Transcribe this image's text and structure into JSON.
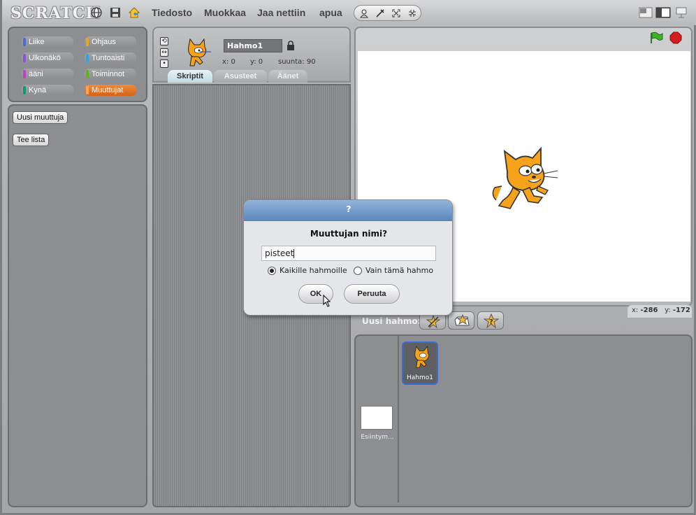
{
  "app": {
    "logo": "SCRATCH"
  },
  "menu": {
    "items": [
      "Tiedosto",
      "Muokkaa",
      "Jaa nettiin",
      "apua"
    ]
  },
  "categories": [
    {
      "label": "Liike",
      "color": "#4a6cd4"
    },
    {
      "label": "Ohjaus",
      "color": "#e1a91a"
    },
    {
      "label": "Ulkonäkö",
      "color": "#8a55d7"
    },
    {
      "label": "Tuntoaisti",
      "color": "#2ca5e2"
    },
    {
      "label": "ääni",
      "color": "#bb42c3"
    },
    {
      "label": "Toiminnot",
      "color": "#5cb712"
    },
    {
      "label": "Kynä",
      "color": "#0e9a6c"
    },
    {
      "label": "Muuttujat",
      "color": "#ee7d16"
    }
  ],
  "palette": {
    "new_variable": "Uusi muuttuja",
    "new_list": "Tee lista"
  },
  "sprite": {
    "name": "Hahmo1",
    "x_label": "x:",
    "x_value": "0",
    "y_label": "y:",
    "y_value": "0",
    "direction_label": "suunta:",
    "direction_value": "90"
  },
  "tabs": [
    "Skriptit",
    "Asusteet",
    "Äänet"
  ],
  "stage": {
    "mouse_x_label": "x:",
    "mouse_x": "-286",
    "mouse_y_label": "y:",
    "mouse_y": "-172"
  },
  "new_sprite_label": "Uusi hahmo:",
  "sprite_list": {
    "sprite_label": "Hahmo1",
    "stage_label": "Esiintym..."
  },
  "dialog": {
    "title": "?",
    "prompt": "Muuttujan nimi?",
    "input_value": "pisteet",
    "radio_all": "Kaikille hahmoille",
    "radio_this": "Vain tämä hahmo",
    "ok": "OK",
    "cancel": "Peruuta"
  },
  "colors": {
    "accent_orange": "#ee7d16",
    "dialog_header": "#6f96c8"
  }
}
